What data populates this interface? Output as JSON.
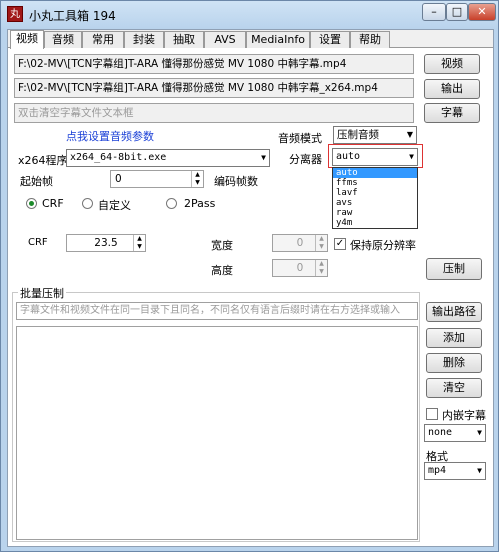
{
  "window": {
    "title": "小丸工具箱 194",
    "icon_char": "丸",
    "min": "–",
    "max": "□",
    "close": "✕"
  },
  "tabs": [
    "视频",
    "音频",
    "常用",
    "封装",
    "抽取",
    "AVS",
    "MediaInfo",
    "设置",
    "帮助"
  ],
  "video_tab": {
    "input_path": "F:\\02-MV\\[TCN字幕组]T-ARA 懂得那份感觉 MV 1080 中韩字幕.mp4",
    "output_path": "F:\\02-MV\\[TCN字幕组]T-ARA 懂得那份感觉 MV 1080 中韩字幕_x264.mp4",
    "subtitle_placeholder": "双击清空字幕文件文本框",
    "btn_video": "视频",
    "btn_output": "输出",
    "btn_subtitle": "字幕",
    "audio_settings_link": "点我设置音频参数",
    "audio_mode_label": "音频模式",
    "audio_mode_value": "压制音频",
    "x264_label": "x264程序",
    "x264_value": "x264_64-8bit.exe",
    "demuxer_label": "分离器",
    "demuxer_value": "auto",
    "demuxer_options": [
      "auto",
      "ffms",
      "lavf",
      "avs",
      "raw",
      "y4m"
    ],
    "start_frame_label": "起始帧",
    "start_frame_value": "0",
    "encode_frames_label": "编码帧数",
    "rc_modes": [
      "CRF",
      "自定义",
      "2Pass"
    ],
    "crf_label": "CRF",
    "crf_value": "23.5",
    "width_label": "宽度",
    "width_value": "0",
    "height_label": "高度",
    "height_value": "0",
    "keep_res_label": "保持原分辨率",
    "keep_res_checked": true,
    "btn_encode": "压制",
    "batch_label": "批量压制",
    "batch_hint": "字幕文件和视频文件在同一目录下且同名，不同名仅有语言后缀时请在右方选择或输入",
    "btn_out_path": "输出路径",
    "btn_add": "添加",
    "btn_delete": "删除",
    "btn_clear": "清空",
    "embed_sub_label": "内嵌字幕",
    "sub_lang_value": "none",
    "format_label": "格式",
    "format_value": "mp4"
  }
}
